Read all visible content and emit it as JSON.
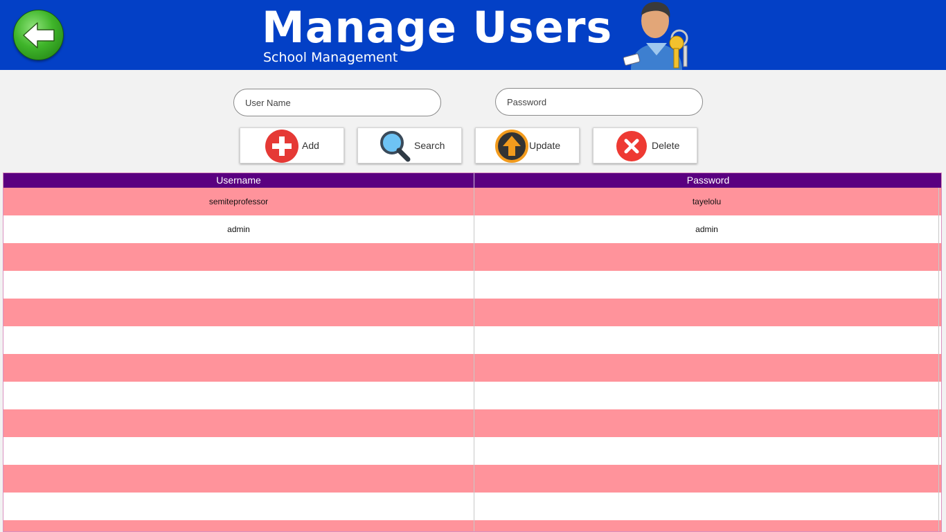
{
  "header": {
    "title": "Manage Users",
    "subtitle": "School Management",
    "bg_color": "#0340c6",
    "back_icon": "back-arrow-icon",
    "logo_icon": "user-with-keys-icon"
  },
  "form": {
    "username": {
      "placeholder": "User Name",
      "value": ""
    },
    "password": {
      "placeholder": "Password",
      "value": ""
    }
  },
  "buttons": {
    "add": {
      "label": "Add",
      "icon": "plus-icon"
    },
    "search": {
      "label": "Search",
      "icon": "magnifier-icon"
    },
    "update": {
      "label": "Update",
      "icon": "upload-arrow-icon"
    },
    "delete": {
      "label": "Delete",
      "icon": "close-x-icon"
    }
  },
  "table": {
    "columns": [
      "Username",
      "Password"
    ],
    "header_color": "#5a0080",
    "stripe_color": "#ff939b",
    "rows": [
      {
        "username": "semiteprofessor",
        "password": "tayelolu"
      },
      {
        "username": "admin",
        "password": "admin"
      },
      {
        "username": "",
        "password": ""
      },
      {
        "username": "",
        "password": ""
      },
      {
        "username": "",
        "password": ""
      },
      {
        "username": "",
        "password": ""
      },
      {
        "username": "",
        "password": ""
      },
      {
        "username": "",
        "password": ""
      },
      {
        "username": "",
        "password": ""
      },
      {
        "username": "",
        "password": ""
      },
      {
        "username": "",
        "password": ""
      },
      {
        "username": "",
        "password": ""
      },
      {
        "username": "",
        "password": ""
      }
    ]
  }
}
